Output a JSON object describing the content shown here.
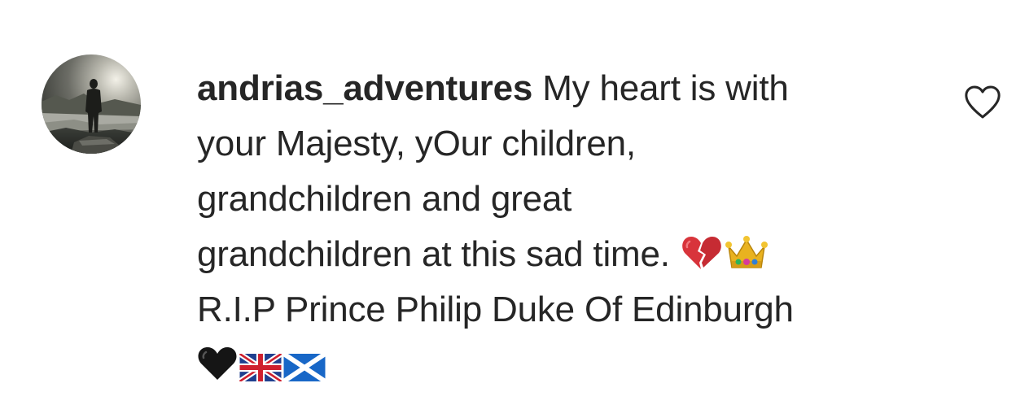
{
  "comment": {
    "username": "andrias_adventures",
    "text_lines": [
      "My heart is with",
      "your Majesty, yOur children,",
      "grandchildren and great",
      "grandchildren at this sad time.",
      "R.I.P Prince Philip Duke Of Edinburgh"
    ],
    "emojis": {
      "line4": [
        "broken-heart-icon",
        "crown-icon"
      ],
      "line6": [
        "black-heart-icon",
        "uk-flag-icon",
        "scotland-flag-icon"
      ]
    }
  },
  "like_icon": "heart-outline-icon"
}
